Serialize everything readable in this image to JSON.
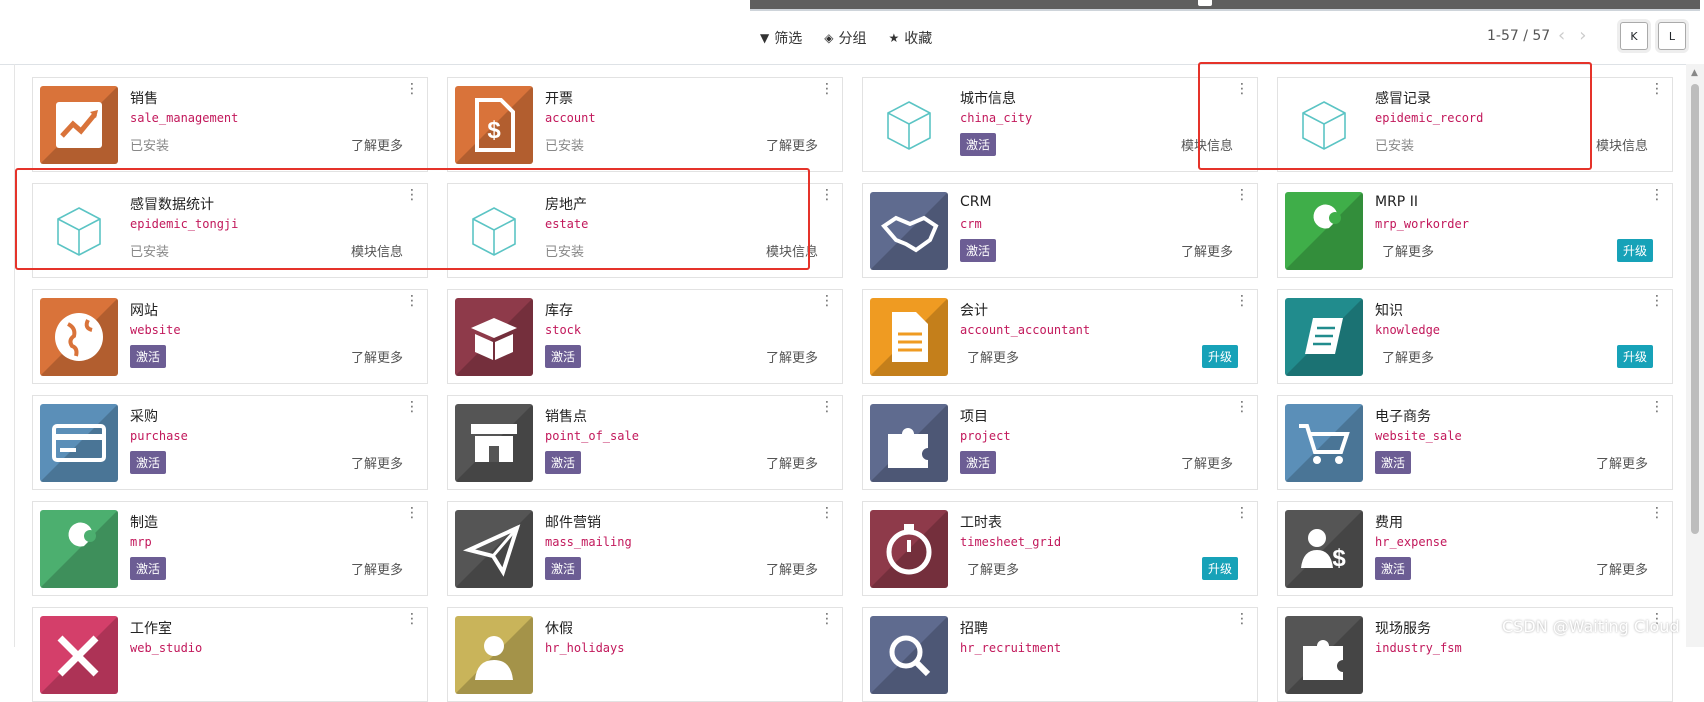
{
  "toolbar": {
    "filters_label": "筛选",
    "group_label": "分组",
    "favorites_label": "收藏",
    "pager": "1-57 / 57",
    "view_k": "K",
    "view_l": "L"
  },
  "cards": [
    {
      "name": "销售",
      "tech": "sale_management",
      "status": "已安装",
      "action": "了解更多",
      "icon": "chart-icon",
      "color": "#d9733a"
    },
    {
      "name": "开票",
      "tech": "account",
      "status": "已安装",
      "action": "了解更多",
      "icon": "invoice-icon",
      "color": "#d9733a"
    },
    {
      "name": "城市信息",
      "tech": "china_city",
      "badge": "激活",
      "action": "模块信息",
      "icon": "cube-icon",
      "color": "#ffffff"
    },
    {
      "name": "感冒记录",
      "tech": "epidemic_record",
      "status": "已安装",
      "action": "模块信息",
      "icon": "cube-icon",
      "color": "#ffffff"
    },
    {
      "name": "感冒数据统计",
      "tech": "epidemic_tongji",
      "status": "已安装",
      "action": "模块信息",
      "icon": "cube-icon",
      "color": "#ffffff"
    },
    {
      "name": "房地产",
      "tech": "estate",
      "status": "已安装",
      "action": "模块信息",
      "icon": "cube-icon",
      "color": "#ffffff"
    },
    {
      "name": "CRM",
      "tech": "crm",
      "badge": "激活",
      "action": "了解更多",
      "icon": "handshake-icon",
      "color": "#5f6b8f"
    },
    {
      "name": "MRP II",
      "tech": "mrp_workorder",
      "learn_left": "了解更多",
      "upgrade": "升级",
      "icon": "wrench-icon",
      "color": "#3fae49"
    },
    {
      "name": "网站",
      "tech": "website",
      "badge": "激活",
      "action": "了解更多",
      "icon": "globe-icon",
      "color": "#d9733a"
    },
    {
      "name": "库存",
      "tech": "stock",
      "badge": "激活",
      "action": "了解更多",
      "icon": "box-icon",
      "color": "#8e3a4a"
    },
    {
      "name": "会计",
      "tech": "account_accountant",
      "learn_left": "了解更多",
      "upgrade": "升级",
      "icon": "document-icon",
      "color": "#ef9b22"
    },
    {
      "name": "知识",
      "tech": "knowledge",
      "learn_left": "了解更多",
      "upgrade": "升级",
      "icon": "book-icon",
      "color": "#218c8d"
    },
    {
      "name": "采购",
      "tech": "purchase",
      "badge": "激活",
      "action": "了解更多",
      "icon": "credit-card-icon",
      "color": "#5b8fb8"
    },
    {
      "name": "销售点",
      "tech": "point_of_sale",
      "badge": "激活",
      "action": "了解更多",
      "icon": "shop-icon",
      "color": "#555555"
    },
    {
      "name": "项目",
      "tech": "project",
      "badge": "激活",
      "action": "了解更多",
      "icon": "puzzle-icon",
      "color": "#5f6b8f"
    },
    {
      "name": "电子商务",
      "tech": "website_sale",
      "badge": "激活",
      "action": "了解更多",
      "icon": "cart-icon",
      "color": "#5b8fb8"
    },
    {
      "name": "制造",
      "tech": "mrp",
      "badge": "激活",
      "action": "了解更多",
      "icon": "wrench-icon",
      "color": "#4caf6f"
    },
    {
      "name": "邮件营销",
      "tech": "mass_mailing",
      "badge": "激活",
      "action": "了解更多",
      "icon": "paper-plane-icon",
      "color": "#555555"
    },
    {
      "name": "工时表",
      "tech": "timesheet_grid",
      "learn_left": "了解更多",
      "upgrade": "升级",
      "icon": "stopwatch-icon",
      "color": "#8e3a4a"
    },
    {
      "name": "费用",
      "tech": "hr_expense",
      "badge": "激活",
      "action": "了解更多",
      "icon": "user-dollar-icon",
      "color": "#555555"
    },
    {
      "name": "工作室",
      "tech": "web_studio",
      "icon": "tools-icon",
      "color": "#d43f6a"
    },
    {
      "name": "休假",
      "tech": "hr_holidays",
      "icon": "person-icon",
      "color": "#c9b45a"
    },
    {
      "name": "招聘",
      "tech": "hr_recruitment",
      "icon": "search-icon",
      "color": "#5f6b8f"
    },
    {
      "name": "现场服务",
      "tech": "industry_fsm",
      "icon": "puzzle-icon",
      "color": "#555555"
    }
  ],
  "watermark": "CSDN @Waiting Cloud"
}
